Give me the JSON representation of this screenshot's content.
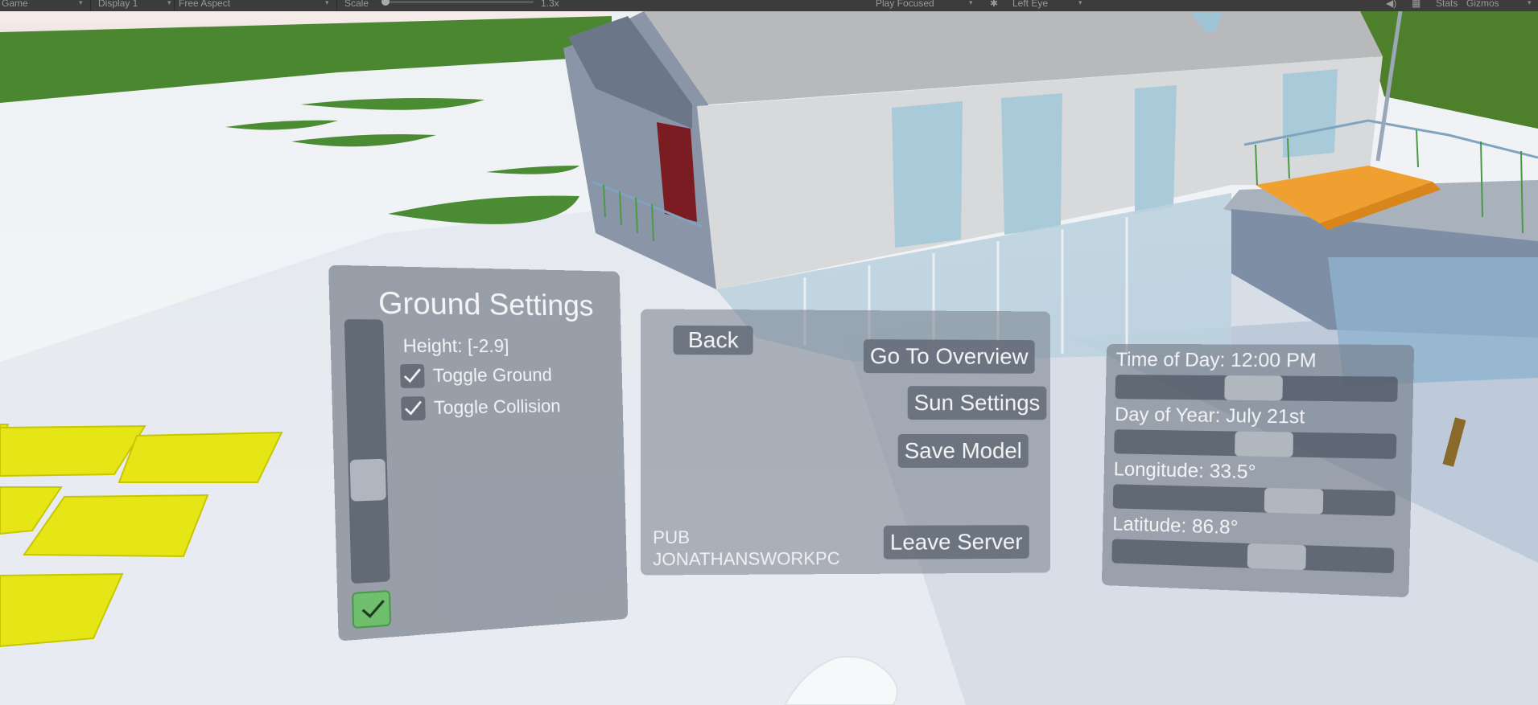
{
  "editor_toolbar": {
    "view": "Game",
    "display": "Display 1",
    "aspect": "Free Aspect",
    "scale_label": "Scale",
    "scale_value": "1.3x",
    "play_mode": "Play Focused",
    "eye": "Left Eye",
    "stats": "Stats",
    "gizmos": "Gizmos"
  },
  "ground_settings": {
    "title": "Ground Settings",
    "height": "Height: [-2.9]",
    "toggle_ground": {
      "label": "Toggle Ground",
      "checked": true
    },
    "toggle_collision": {
      "label": "Toggle Collision",
      "checked": true
    },
    "scrollbar_position": 0.5
  },
  "main_menu": {
    "back": "Back",
    "go_to_overview": "Go To Overview",
    "sun_settings": "Sun Settings",
    "save_model": "Save Model",
    "leave_server": "Leave Server",
    "server_type": "PUB",
    "server_name": "JONATHANSWORKPC"
  },
  "sun_settings": {
    "time_of_day": {
      "label": "Time of Day: 12:00 PM",
      "value": 0.5
    },
    "day_of_year": {
      "label": "Day of Year: July 21st",
      "value": 0.55
    },
    "longitude": {
      "label": "Longitude: 33.5°",
      "value": 0.69
    },
    "latitude": {
      "label": "Latitude: 86.8°",
      "value": 0.62
    }
  },
  "colors": {
    "accent_confirm": "#6fbf6f",
    "lawn": "#4d8a2f",
    "pads": "#e8e81c",
    "stairs": "#f0a030",
    "door": "#7a1a22"
  }
}
